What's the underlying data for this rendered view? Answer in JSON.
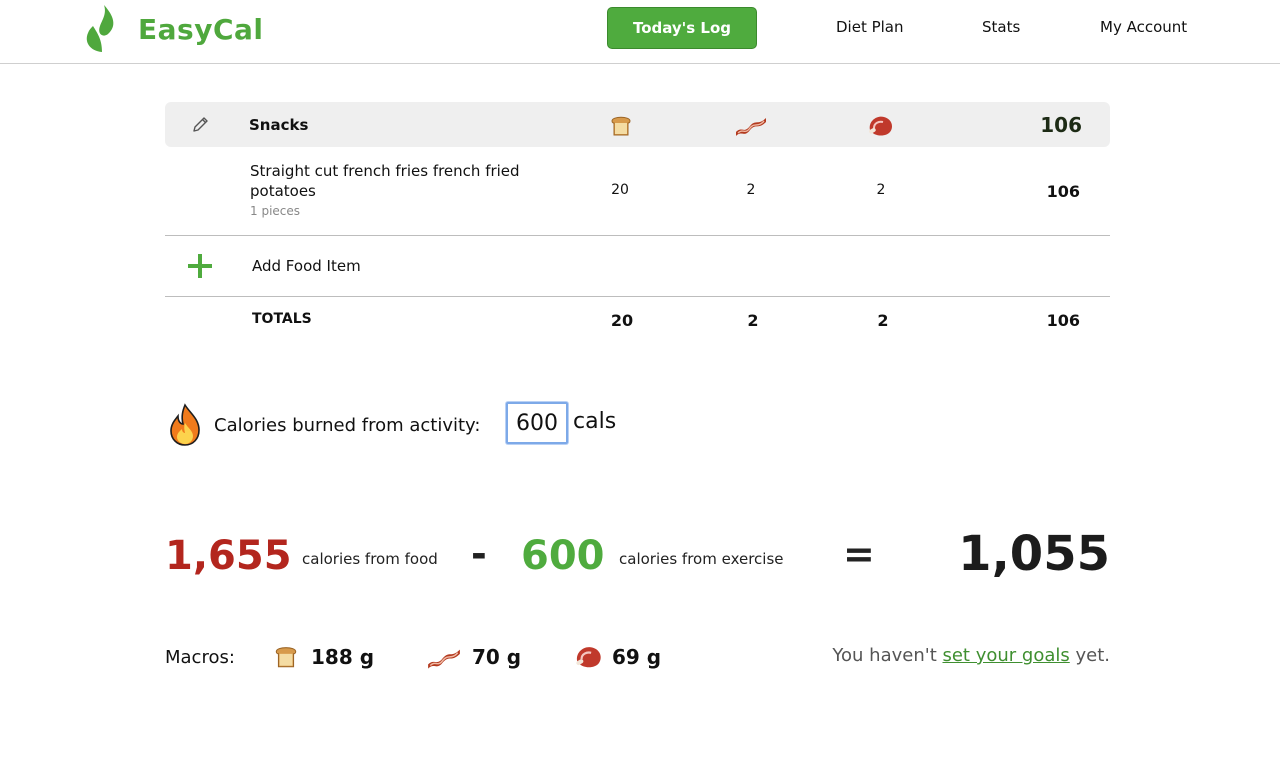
{
  "app": {
    "name": "EasyCal",
    "brand_color": "#4fa83d"
  },
  "nav": {
    "todays_log": "Today's Log",
    "diet_plan": "Diet Plan",
    "stats": "Stats",
    "my_account": "My Account"
  },
  "meal": {
    "title": "Snacks",
    "header_total": "106",
    "icons": [
      "bread-icon",
      "bacon-icon",
      "meat-icon"
    ],
    "items": [
      {
        "name": "Straight cut french fries french fried potatoes",
        "quantity": "1 pieces",
        "carbs": "20",
        "fat": "2",
        "protein": "2",
        "calories": "106"
      }
    ],
    "add_label": "Add Food Item",
    "totals": {
      "label": "TOTALS",
      "carbs": "20",
      "fat": "2",
      "protein": "2",
      "calories": "106"
    }
  },
  "activity": {
    "label": "Calories burned from activity:",
    "value": "600",
    "unit": "cals"
  },
  "summary": {
    "food_value": "1,655",
    "food_label": "calories from food",
    "minus": "-",
    "exercise_value": "600",
    "exercise_label": "calories from exercise",
    "equals": "=",
    "net_value": "1,055",
    "colors": {
      "food": "#b3261e",
      "exercise": "#4fab3e"
    }
  },
  "macros": {
    "label": "Macros:",
    "carbs": "188 g",
    "fat": "70 g",
    "protein": "69 g",
    "goals_prefix": "You haven't ",
    "goals_link": "set your goals",
    "goals_suffix": " yet."
  }
}
